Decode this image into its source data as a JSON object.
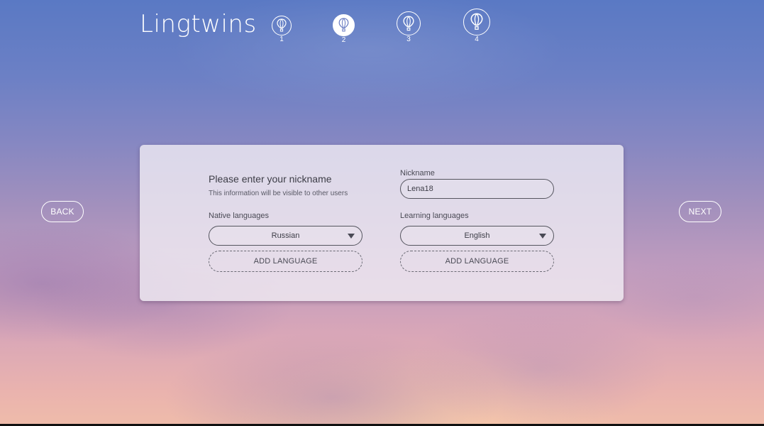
{
  "header": {
    "logo_text": "Lingtwins",
    "steps": [
      {
        "num": "1",
        "icon": "balloon-icon",
        "active": false
      },
      {
        "num": "2",
        "icon": "balloon-icon",
        "active": true
      },
      {
        "num": "3",
        "icon": "balloon-icon",
        "active": false
      },
      {
        "num": "4",
        "icon": "balloon-icon",
        "active": false
      }
    ]
  },
  "nav": {
    "back_label": "BACK",
    "next_label": "NEXT"
  },
  "form": {
    "heading": "Please enter your nickname",
    "subtext": "This information will be visible to other users",
    "nickname_label": "Nickname",
    "nickname_value": "Lena18",
    "native_label": "Native languages",
    "native_value": "Russian",
    "learning_label": "Learning languages",
    "learning_value": "English",
    "add_language_label": "ADD LANGUAGE"
  },
  "colors": {
    "sky_top": "#5a79c4",
    "sky_bottom": "#efbcaa",
    "card_bg": "#f0ecf4",
    "text_dark": "#3d3d47"
  }
}
